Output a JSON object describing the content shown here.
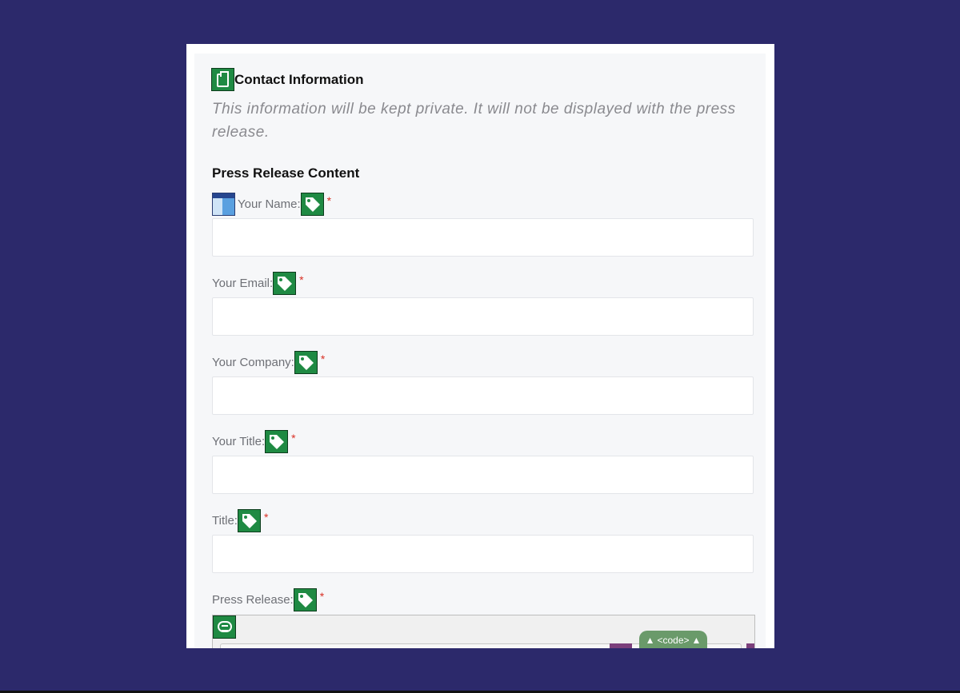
{
  "colors": {
    "background": "#2c296b",
    "panel": "#f6f7f9",
    "icon_green": "#1f8a43",
    "required": "#d93025"
  },
  "section": {
    "icon": "clipboard-icon",
    "title": "Contact Information",
    "privacy_note": "This information will be kept private. It will not be displayed with the press release."
  },
  "content_heading": "Press Release Content",
  "fields": [
    {
      "label": "Your Name:",
      "required": "*",
      "icon": "tag-icon",
      "value": ""
    },
    {
      "label": "Your Email:",
      "required": "*",
      "icon": "tag-icon",
      "value": ""
    },
    {
      "label": "Your Company:",
      "required": "*",
      "icon": "tag-icon",
      "value": ""
    },
    {
      "label": "Your Title:",
      "required": "*",
      "icon": "tag-icon",
      "value": ""
    },
    {
      "label": "Title:",
      "required": "*",
      "icon": "tag-icon",
      "value": ""
    },
    {
      "label": "Press Release:",
      "required": "*",
      "icon": "tag-icon",
      "value": ""
    }
  ],
  "editor": {
    "toolbar_icon": "chat-bubble-icon",
    "code_toggle": "<code>",
    "code_arrow": "▲"
  }
}
